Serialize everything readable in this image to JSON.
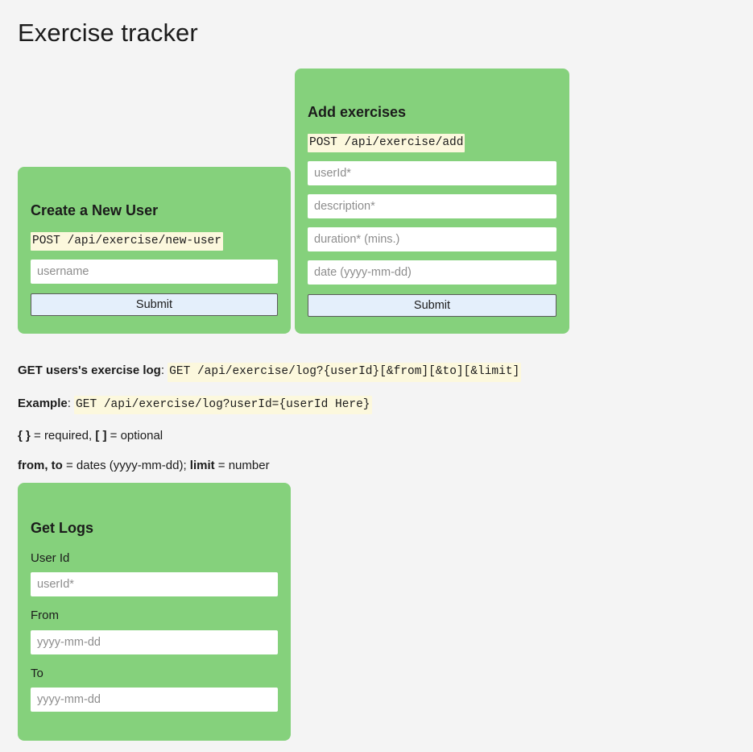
{
  "page": {
    "title": "Exercise tracker",
    "background_color": "#f4f4f4",
    "card_color": "#85d17c",
    "code_highlight_color": "#fcf8dd",
    "button_color": "#e4effb"
  },
  "create_user_card": {
    "title": "Create a New User",
    "endpoint": "POST /api/exercise/new-user",
    "username_placeholder": "username",
    "submit_label": "Submit"
  },
  "add_exercises_card": {
    "title": "Add exercises",
    "endpoint": "POST /api/exercise/add",
    "user_id_placeholder": "userId*",
    "description_placeholder": "description*",
    "duration_placeholder": "duration* (mins.)",
    "date_placeholder": "date (yyyy-mm-dd)",
    "submit_label": "Submit"
  },
  "docs": {
    "log_label": "GET users's exercise log",
    "log_separator": ": ",
    "log_endpoint": "GET /api/exercise/log?{userId}[&from][&to][&limit]",
    "example_label": "Example",
    "example_separator": ": ",
    "example_endpoint": "GET /api/exercise/log?userId={userId Here}",
    "legend_braces": "{ }",
    "legend_braces_text": " = required, ",
    "legend_brackets": "[ ]",
    "legend_brackets_text": " = optional",
    "params_from_to": "from, to",
    "params_from_to_text": " = dates (yyyy-mm-dd); ",
    "params_limit": "limit",
    "params_limit_text": " = number"
  },
  "get_logs_card": {
    "title": "Get Logs",
    "user_id_label": "User Id",
    "user_id_placeholder": "userId*",
    "from_label": "From",
    "from_placeholder": "yyyy-mm-dd",
    "to_label": "To",
    "to_placeholder": "yyyy-mm-dd"
  }
}
